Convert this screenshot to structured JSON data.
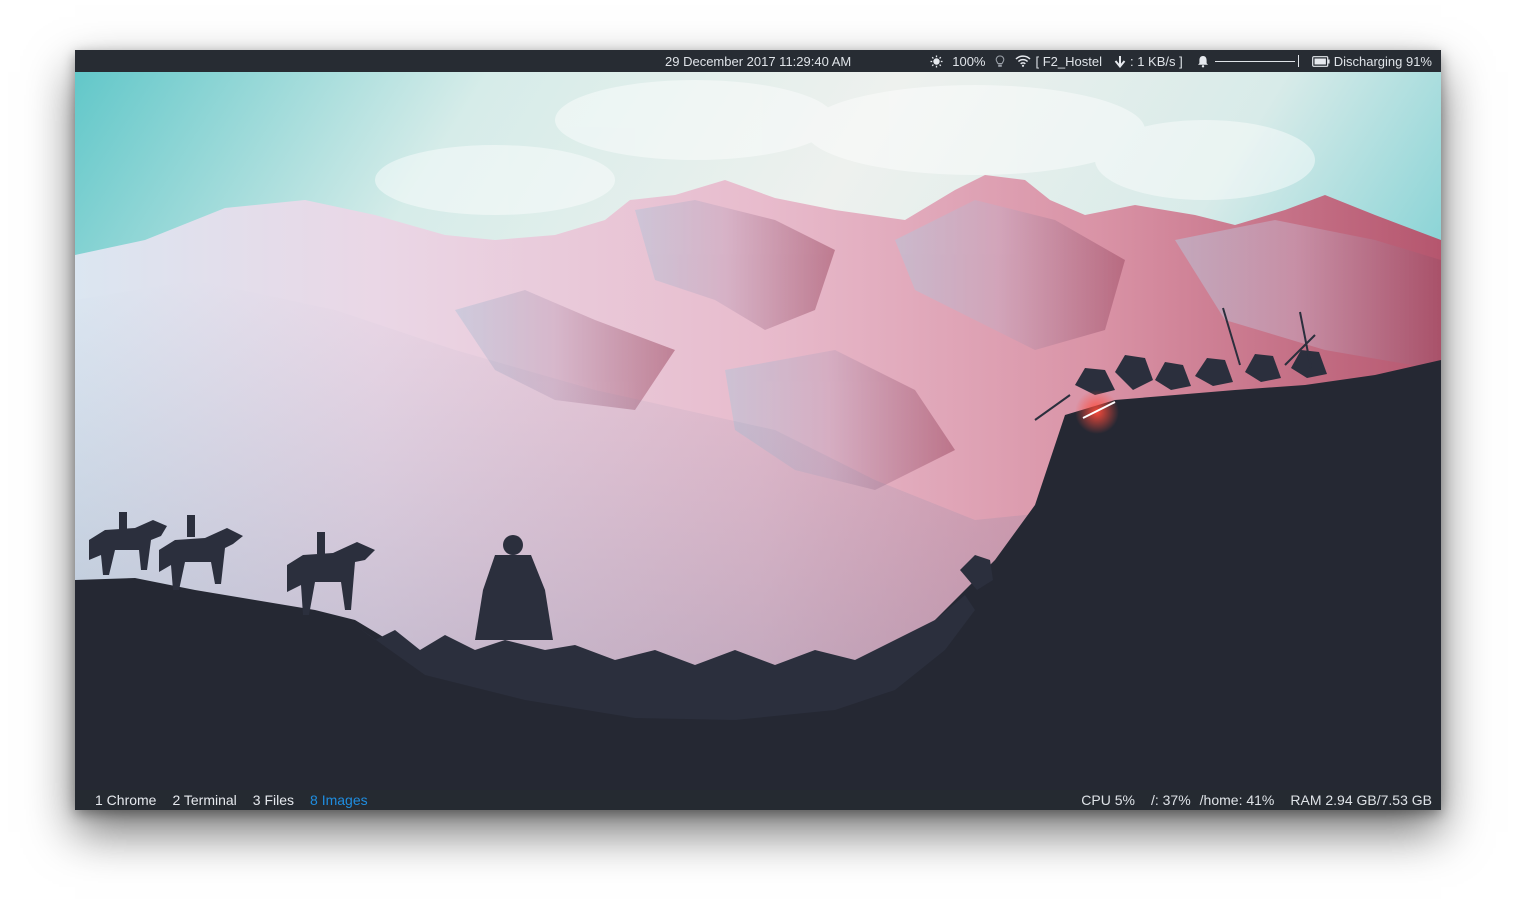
{
  "top_bar": {
    "clock": "29 December 2017 11:29:40 AM",
    "brightness": {
      "icon": "brightness-icon",
      "value": "100%"
    },
    "bulb": {
      "icon": "lightbulb-icon"
    },
    "wifi": {
      "icon": "wifi-icon",
      "text": "[ F2_Hostel"
    },
    "network": {
      "icon": "download-arrow-icon",
      "text": ": 1 KB/s ]"
    },
    "volume": {
      "icon": "bell-icon",
      "level": 0.95
    },
    "battery": {
      "icon": "battery-icon",
      "text": "Discharging 91%"
    }
  },
  "bottom_bar": {
    "workspaces": [
      {
        "label": "1 Chrome",
        "active": false
      },
      {
        "label": "2 Terminal",
        "active": false
      },
      {
        "label": "3 Files",
        "active": false
      },
      {
        "label": "8 Images",
        "active": true
      }
    ],
    "cpu": "CPU 5%",
    "disk_root": "/: 37%",
    "disk_home": "/home: 41%",
    "ram": "RAM 2.94 GB/7.53 GB"
  },
  "colors": {
    "bar_bg": "#272c33",
    "bar_text": "#dfe3e8",
    "active_workspace": "#1f8de0"
  }
}
